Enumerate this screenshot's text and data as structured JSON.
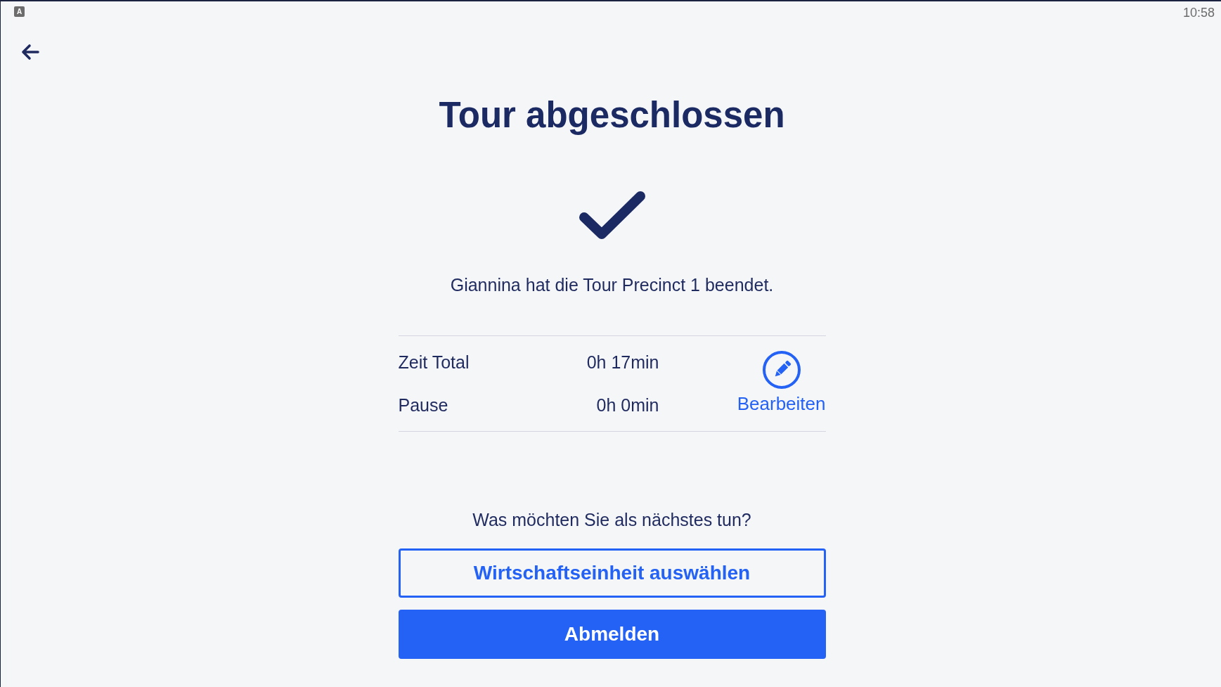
{
  "status_bar": {
    "notification": "A",
    "time": "10:58"
  },
  "title": "Tour abgeschlossen",
  "message": "Giannina hat die Tour Precinct 1 beendet.",
  "summary": {
    "rows": [
      {
        "label": "Zeit Total",
        "value": "0h 17min"
      },
      {
        "label": "Pause",
        "value": "0h 0min"
      }
    ],
    "edit_label": "Bearbeiten"
  },
  "prompt": "Was möchten Sie als nächstes tun?",
  "actions": [
    {
      "label": "Wirtschaftseinheit auswählen",
      "kind": "outline"
    },
    {
      "label": "Abmelden",
      "kind": "primary"
    }
  ]
}
